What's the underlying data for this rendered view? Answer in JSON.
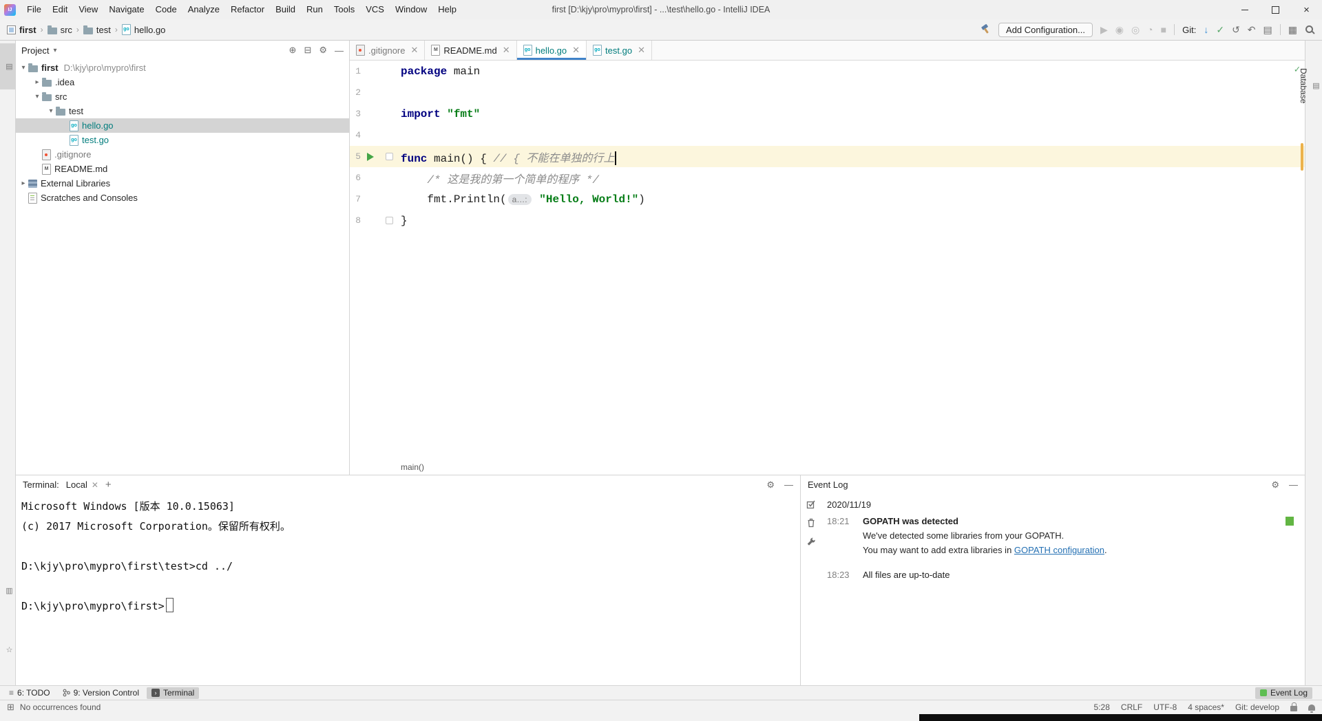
{
  "colors": {
    "tab_underline_blue": "#4083c9",
    "keyword_navy": "#000080",
    "string_green": "#067d17",
    "comment_gray": "#8c8c8c",
    "vcs_teal": "#007c7c",
    "run_green": "#59a869",
    "event_indicator_green": "#62b543",
    "link_blue": "#2470b3",
    "selection_gray": "#d4d4d4",
    "current_line_yellow": "#fcf6dd"
  },
  "title_bar": {
    "app_title": "first [D:\\kjy\\pro\\mypro\\first] - ...\\test\\hello.go - IntelliJ IDEA",
    "menu_items": [
      "File",
      "Edit",
      "View",
      "Navigate",
      "Code",
      "Analyze",
      "Refactor",
      "Build",
      "Run",
      "Tools",
      "VCS",
      "Window",
      "Help"
    ]
  },
  "toolbar": {
    "breadcrumbs": [
      {
        "label": "first",
        "icon": "proj",
        "bold": true
      },
      {
        "label": "src",
        "icon": "folder"
      },
      {
        "label": "test",
        "icon": "folder"
      },
      {
        "label": "hello.go",
        "icon": "go"
      }
    ],
    "add_configuration_label": "Add Configuration...",
    "git_label": "Git:"
  },
  "stripes": {
    "left_top": [
      {
        "label": "1: Project",
        "icon": "project",
        "active": true
      }
    ],
    "left_bottom": [
      {
        "label": "7: Structure",
        "icon": "structure"
      },
      {
        "label": "2: Favorites",
        "icon": "favorites"
      }
    ],
    "right": [
      {
        "label": "Database",
        "icon": "database"
      }
    ]
  },
  "project_panel": {
    "title": "Project",
    "tree": [
      {
        "label": "first",
        "suffix": "D:\\kjy\\pro\\mypro\\first",
        "icon": "folder",
        "chevron": "expanded",
        "indent": 0,
        "bold": true
      },
      {
        "label": ".idea",
        "icon": "folder",
        "chevron": "collapsed",
        "indent": 1
      },
      {
        "label": "src",
        "icon": "folder",
        "chevron": "expanded",
        "indent": 1
      },
      {
        "label": "test",
        "icon": "folder",
        "chevron": "expanded",
        "indent": 2
      },
      {
        "label": "hello.go",
        "icon": "go",
        "indent": 3,
        "selected": true,
        "color": "#007c7c"
      },
      {
        "label": "test.go",
        "icon": "go",
        "indent": 3,
        "color": "#007c7c"
      },
      {
        "label": ".gitignore",
        "icon": "git",
        "indent": 1,
        "color": "#7a7a7a"
      },
      {
        "label": "README.md",
        "icon": "md",
        "indent": 1
      },
      {
        "label": "External Libraries",
        "icon": "lib",
        "chevron": "collapsed",
        "indent": 0
      },
      {
        "label": "Scratches and Consoles",
        "icon": "scratch",
        "indent": 0
      }
    ]
  },
  "editor": {
    "tabs": [
      {
        "label": ".gitignore",
        "icon": "git",
        "color": "#7a7a7a"
      },
      {
        "label": "README.md",
        "icon": "md",
        "color": "#262626"
      },
      {
        "label": "hello.go",
        "icon": "go",
        "color": "#007c7c",
        "active": true
      },
      {
        "label": "test.go",
        "icon": "go",
        "color": "#007c7c"
      }
    ],
    "lines": [
      {
        "num": "1",
        "segs": [
          [
            "kw",
            "package"
          ],
          [
            "pl",
            " main"
          ]
        ]
      },
      {
        "num": "2",
        "segs": []
      },
      {
        "num": "3",
        "segs": [
          [
            "kw",
            "import"
          ],
          [
            "pl",
            " "
          ],
          [
            "str",
            "\"fmt\""
          ]
        ]
      },
      {
        "num": "4",
        "segs": []
      },
      {
        "num": "5",
        "current": true,
        "run": true,
        "fold": true,
        "segs": [
          [
            "kw",
            "func"
          ],
          [
            "pl",
            " main() { "
          ],
          [
            "cmt",
            "// { 不能在单独的行上"
          ],
          [
            "caret",
            ""
          ]
        ]
      },
      {
        "num": "6",
        "segs": [
          [
            "pl",
            "    "
          ],
          [
            "cmt",
            "/* 这是我的第一个简单的程序 */"
          ]
        ]
      },
      {
        "num": "7",
        "segs": [
          [
            "pl",
            "    fmt.Println("
          ],
          [
            "hint",
            "a…:"
          ],
          [
            "pl",
            " "
          ],
          [
            "str",
            "\"Hello, World!\""
          ],
          [
            "pl",
            ")"
          ]
        ]
      },
      {
        "num": "8",
        "fold": true,
        "segs": [
          [
            "pl",
            "}"
          ]
        ]
      }
    ],
    "breadcrumb": "main()"
  },
  "terminal": {
    "title": "Terminal:",
    "tab_label": "Local",
    "lines": [
      "Microsoft Windows [版本 10.0.15063]",
      "(c) 2017 Microsoft Corporation。保留所有权利。",
      "",
      "D:\\kjy\\pro\\mypro\\first\\test>cd ../",
      "",
      "D:\\kjy\\pro\\mypro\\first>"
    ]
  },
  "event_log": {
    "title": "Event Log",
    "date": "2020/11/19",
    "entries": [
      {
        "time": "18:21",
        "title": "GOPATH was detected",
        "bold": true,
        "indicator": true,
        "details": [
          {
            "text": "We've detected some libraries from your GOPATH."
          },
          {
            "text": "You may want to add extra libraries in ",
            "link": "GOPATH configuration",
            "after": "."
          }
        ]
      },
      {
        "time": "18:23",
        "title": "All files are up-to-date",
        "bold": false,
        "details": []
      }
    ]
  },
  "bottom_bar": {
    "left": [
      {
        "label": "6: TODO",
        "icon": "todo"
      },
      {
        "label": "9: Version Control",
        "icon": "vcs"
      },
      {
        "label": "Terminal",
        "icon": "terminal",
        "active": true
      }
    ],
    "right": [
      {
        "label": "Event Log",
        "icon": "eventlog",
        "active": true
      }
    ]
  },
  "status_bar": {
    "message": "No occurrences found",
    "caret_position": "5:28",
    "line_separator": "CRLF",
    "encoding": "UTF-8",
    "indent_style": "4 spaces*",
    "git_branch": "Git: develop"
  }
}
